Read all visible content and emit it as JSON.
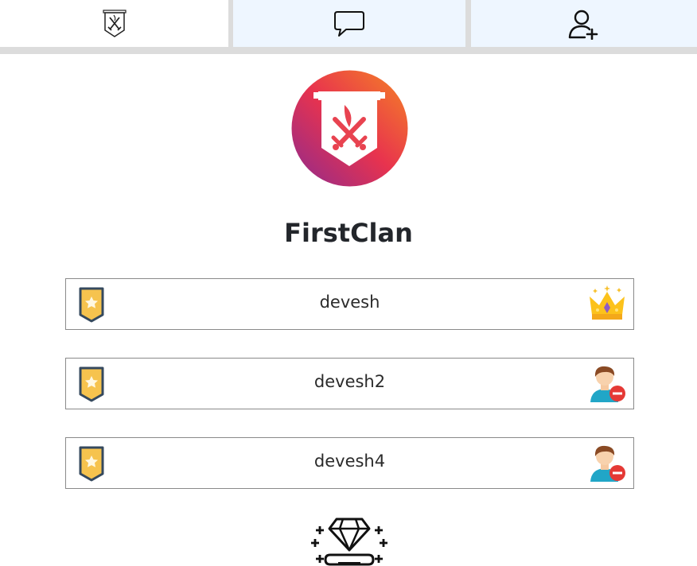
{
  "tabs": [
    {
      "icon": "clan-banner-icon",
      "active": true
    },
    {
      "icon": "chat-icon",
      "active": false
    },
    {
      "icon": "add-user-icon",
      "active": false
    }
  ],
  "clan": {
    "name": "FirstClan",
    "emblem_icon": "clan-emblem-icon"
  },
  "members": [
    {
      "name": "devesh",
      "rank_icon": "rank-badge-icon",
      "role_icon": "crown-icon"
    },
    {
      "name": "devesh2",
      "rank_icon": "rank-badge-icon",
      "role_icon": "remove-member-icon"
    },
    {
      "name": "devesh4",
      "rank_icon": "rank-badge-icon",
      "role_icon": "remove-member-icon"
    }
  ],
  "footer": {
    "icon": "diamond-icon"
  },
  "colors": {
    "tab_active": "#ffffff",
    "tab_inactive": "#eef6ff",
    "tab_separator": "#dcdcdc",
    "emblem_gradient": [
      "#f47a26",
      "#e8334e",
      "#9a2a8c"
    ],
    "member_border": "#8a8a8a"
  }
}
